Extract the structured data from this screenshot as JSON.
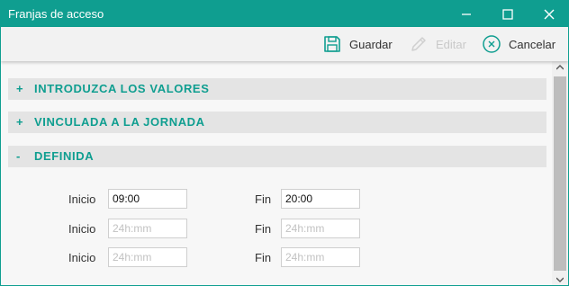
{
  "window": {
    "title": "Franjas de acceso"
  },
  "toolbar": {
    "save_label": "Guardar",
    "edit_label": "Editar",
    "cancel_label": "Cancelar"
  },
  "sections": [
    {
      "sign": "+",
      "title": "INTRODUZCA LOS VALORES"
    },
    {
      "sign": "+",
      "title": "VINCULADA A LA JORNADA"
    },
    {
      "sign": "-",
      "title": "DEFINIDA"
    }
  ],
  "ranges": [
    {
      "start_label": "Inicio",
      "start_value": "09:00",
      "start_placeholder": "24h:mm",
      "end_label": "Fin",
      "end_value": "20:00",
      "end_placeholder": "24h:mm"
    },
    {
      "start_label": "Inicio",
      "start_value": "",
      "start_placeholder": "24h:mm",
      "end_label": "Fin",
      "end_value": "",
      "end_placeholder": "24h:mm"
    },
    {
      "start_label": "Inicio",
      "start_value": "",
      "start_placeholder": "24h:mm",
      "end_label": "Fin",
      "end_value": "",
      "end_placeholder": "24h:mm"
    }
  ],
  "colors": {
    "accent": "#0f9e90",
    "section_bg": "#e4e4e4",
    "disabled": "#c9c9c9"
  },
  "icons": {
    "save": "floppy-disk-icon",
    "edit": "pencil-icon",
    "cancel": "circle-x-icon",
    "minimize": "minimize-icon",
    "maximize": "maximize-icon",
    "close": "close-icon"
  }
}
